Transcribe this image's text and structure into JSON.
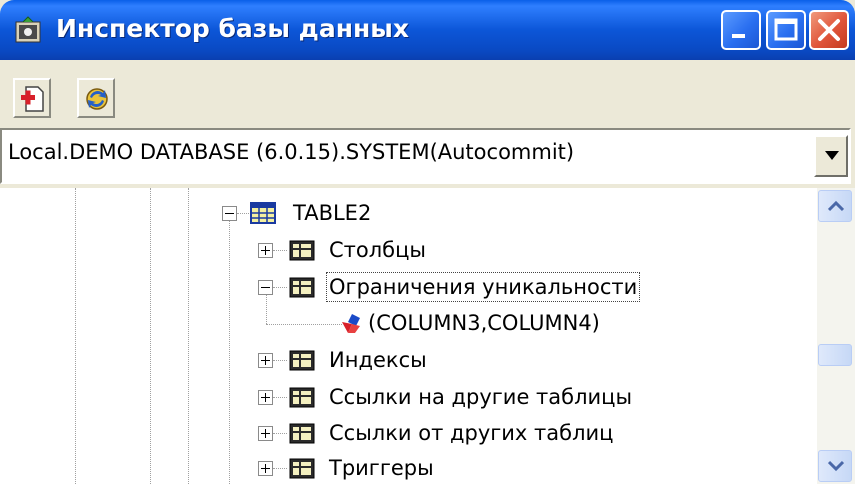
{
  "window": {
    "title": "Инспектор базы данных",
    "icon": "database-inspector-icon",
    "controls": [
      "minimize",
      "maximize",
      "close"
    ]
  },
  "toolbar": {
    "buttons": [
      {
        "name": "new-connection",
        "icon": "document-add-icon"
      },
      {
        "name": "refresh",
        "icon": "refresh-icon"
      }
    ]
  },
  "connection": {
    "selected": "Local.DEMO DATABASE (6.0.15).SYSTEM(Autocommit)"
  },
  "tree": {
    "nodes": [
      {
        "label": "TABLE2",
        "icon": "table-icon",
        "expanded": true
      },
      {
        "label": "Столбцы",
        "icon": "folder-icon",
        "expanded": false
      },
      {
        "label": "Ограничения уникальности",
        "icon": "folder-icon",
        "expanded": true,
        "selected": true
      },
      {
        "label": "(COLUMN3,COLUMN4)",
        "icon": "unique-constraint-icon"
      },
      {
        "label": "Индексы",
        "icon": "folder-icon",
        "expanded": false
      },
      {
        "label": "Ссылки на другие таблицы",
        "icon": "folder-icon",
        "expanded": false
      },
      {
        "label": "Ссылки от других таблиц",
        "icon": "folder-icon",
        "expanded": false
      },
      {
        "label": "Триггеры",
        "icon": "folder-icon",
        "expanded": false
      }
    ]
  },
  "colors": {
    "titlebar": "#0a56d8",
    "close_button": "#e0553a",
    "window_bg": "#ece9d8",
    "selection_border": "#444444"
  }
}
